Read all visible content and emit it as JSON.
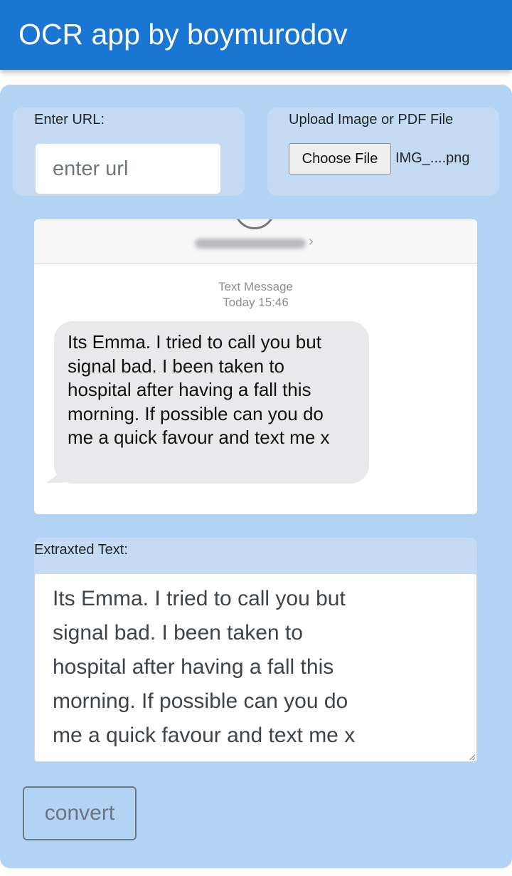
{
  "app": {
    "title": "OCR app by boymurodov"
  },
  "url_section": {
    "label": "Enter URL:",
    "placeholder": "enter url",
    "value": ""
  },
  "upload_section": {
    "label": "Upload Image or PDF File",
    "button_label": "Choose File",
    "file_name": "IMG_....png"
  },
  "preview": {
    "meta_line1": "Text Message",
    "meta_line2": "Today 15:46",
    "chevron": "›",
    "message_lines": [
      "Its Emma. I tried to call you but",
      "signal bad. I been taken to",
      "hospital after having a fall this",
      "morning. If possible can you do",
      "me a quick favour and text me x"
    ]
  },
  "extracted": {
    "label": "Extraxted Text:",
    "lines": [
      "Its Emma. I tried to call you but",
      "signal bad. I been taken to",
      "hospital after having a fall this",
      "morning. If possible can you do",
      "me a quick favour and text me x"
    ]
  },
  "actions": {
    "convert_label": "convert"
  },
  "colors": {
    "appbar": "#1976d2",
    "panel": "#b3d3f5",
    "section_box": "#c5dbf4",
    "bubble": "#e9e9eb"
  }
}
